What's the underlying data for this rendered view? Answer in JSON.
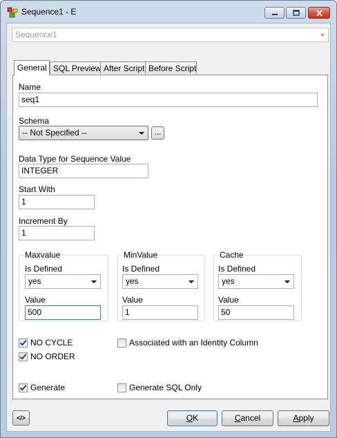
{
  "window": {
    "title": "Sequence1 - E",
    "object_selector": {
      "value": "Sequence1"
    }
  },
  "tabs": [
    {
      "label": "General",
      "active": true
    },
    {
      "label": "SQL Preview",
      "active": false
    },
    {
      "label": "After Script",
      "active": false
    },
    {
      "label": "Before Script",
      "active": false
    }
  ],
  "general": {
    "name_label": "Name",
    "name_value": "seq1",
    "schema_label": "Schema",
    "schema_value": "-- Not Specified --",
    "schema_browse": "...",
    "datatype_label": "Data Type for Sequence Value",
    "datatype_value": "INTEGER",
    "startwith_label": "Start With",
    "startwith_value": "1",
    "increment_label": "Increment By",
    "increment_value": "1"
  },
  "groups": {
    "maxvalue": {
      "title": "Maxvalue",
      "defined_label": "Is Defined",
      "defined_value": "yes",
      "value_label": "Value",
      "value": "500"
    },
    "minvalue": {
      "title": "MinValue",
      "defined_label": "Is Defined",
      "defined_value": "yes",
      "value_label": "Value",
      "value": "1"
    },
    "cache": {
      "title": "Cache",
      "defined_label": "Is Defined",
      "defined_value": "yes",
      "value_label": "Value",
      "value": "50"
    }
  },
  "options": {
    "no_cycle": {
      "label": "NO CYCLE",
      "checked": true
    },
    "no_order": {
      "label": "NO ORDER",
      "checked": true
    },
    "identity": {
      "label": "Associated with an Identity Column",
      "checked": false
    },
    "generate": {
      "label": "Generate",
      "checked": true
    },
    "generate_sql_only": {
      "label": "Generate SQL Only",
      "checked": false
    }
  },
  "buttons": {
    "ok": {
      "label": "OK",
      "mnemonic": "O",
      "rest": "K"
    },
    "cancel": {
      "label": "Cancel",
      "mnemonic": "C",
      "rest": "ancel"
    },
    "apply": {
      "label": "Apply",
      "mnemonic": "A",
      "rest": "pply"
    },
    "code_icon": "</>"
  },
  "colors": {
    "window_frame": "#bccce0",
    "focus_border": "#3d7bad",
    "close_red": "#c2351c"
  }
}
